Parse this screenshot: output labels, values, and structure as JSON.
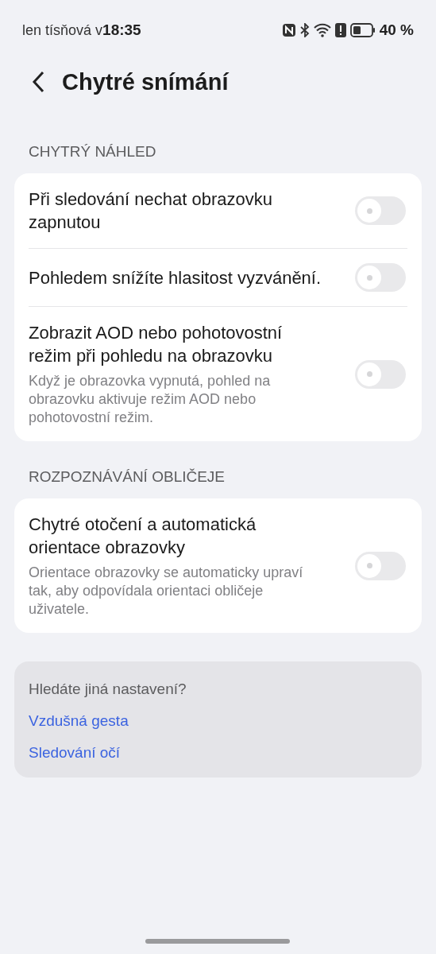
{
  "status_bar": {
    "carrier": "len tísňová v",
    "time": "18:35",
    "battery": "40 %"
  },
  "header": {
    "title": "Chytré snímání"
  },
  "sections": [
    {
      "title": "CHYTRÝ NÁHLED",
      "items": [
        {
          "label": "Při sledování nechat obrazovku zapnutou",
          "on": false
        },
        {
          "label": "Pohledem snížíte hlasitost vyzvánění.",
          "on": false
        },
        {
          "label": "Zobrazit AOD nebo pohotovostní režim při pohledu na obrazovku",
          "description": "Když je obrazovka vypnutá, pohled na obrazovku aktivuje režim AOD nebo pohotovostní režim.",
          "on": false
        }
      ]
    },
    {
      "title": "ROZPOZNÁVÁNÍ OBLIČEJE",
      "items": [
        {
          "label": "Chytré otočení a automatická orientace obrazovky",
          "description": "Orientace obrazovky se automaticky upraví tak, aby odpovídala orientaci obličeje uživatele.",
          "on": false
        }
      ]
    }
  ],
  "suggestions": {
    "title": "Hledáte jiná nastavení?",
    "links": [
      "Vzdušná gesta",
      "Sledování očí"
    ]
  }
}
